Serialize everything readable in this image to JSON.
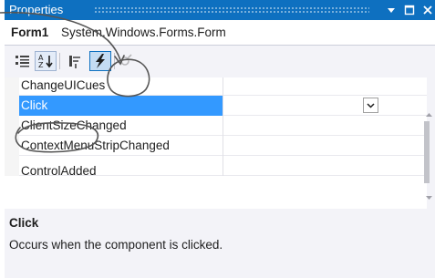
{
  "window": {
    "title": "Properties"
  },
  "object_selector": {
    "name": "Form1",
    "type": "System.Windows.Forms.Form"
  },
  "toolbar": {
    "buttons": [
      "categorized-icon",
      "alphabetical-icon",
      "properties-icon",
      "events-lightning-icon",
      "property-pages-icon"
    ]
  },
  "grid": {
    "rows": [
      {
        "label": "ChangeUICues"
      },
      {
        "label": "Click"
      },
      {
        "label": "ClientSizeChanged"
      },
      {
        "label": "ContextMenuStripChanged"
      },
      {
        "label": "ControlAdded"
      }
    ],
    "selected_index": 1
  },
  "description": {
    "title": "Click",
    "text": "Occurs when the component is clicked."
  },
  "colors": {
    "titlebar": "#0e70c0",
    "selection": "#3399ff",
    "panel": "#f3f3f8"
  }
}
